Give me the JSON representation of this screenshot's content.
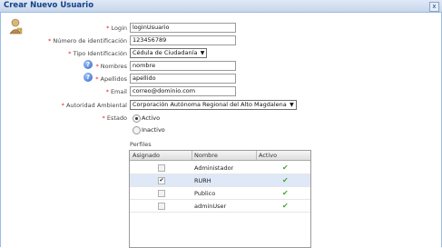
{
  "window": {
    "title": "Crear Nuevo Usuario",
    "close_icon": "x"
  },
  "form": {
    "login": {
      "label": "Login",
      "value": "loginUsuario"
    },
    "numero": {
      "label": "Número de identificación",
      "value": "123456789"
    },
    "tipo": {
      "label": "Tipo Identificación",
      "value": "Cédula de Ciudadanía"
    },
    "nombres": {
      "label": "Nombres",
      "value": "nombre"
    },
    "apellidos": {
      "label": "Apellidos",
      "value": "apellido"
    },
    "email": {
      "label": "Email",
      "value": "correo@dominio.com"
    },
    "autoridad": {
      "label": "Autoridad Ambiental",
      "value": "Corporación Autónoma Regional del Alto Magdalena"
    },
    "estado": {
      "label": "Estado",
      "options": [
        "Activo",
        "Inactivo"
      ],
      "selected": "Activo"
    },
    "required_mark": "*",
    "help_glyph": "?"
  },
  "perfiles": {
    "title": "Perfiles",
    "columns": [
      "Asignado",
      "Nombre",
      "Activo"
    ],
    "rows": [
      {
        "nombre": "Administador",
        "asignado": false,
        "activo": true
      },
      {
        "nombre": "RURH",
        "asignado": true,
        "activo": true
      },
      {
        "nombre": "Publico",
        "asignado": false,
        "activo": true
      },
      {
        "nombre": "adminUser",
        "asignado": false,
        "activo": true
      }
    ],
    "checked_glyph": "✔",
    "active_glyph": "✔"
  },
  "colors": {
    "header_text": "#15428b",
    "required": "#e02020",
    "active_check": "#48a432",
    "selected_row": "#dfe8f6"
  }
}
